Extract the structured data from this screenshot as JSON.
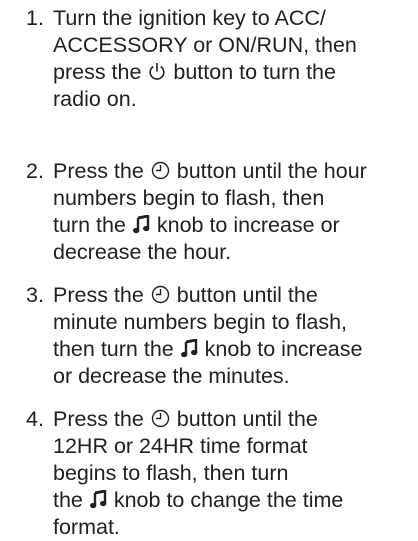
{
  "steps": [
    {
      "number": "1.",
      "lines": [
        [
          "Turn the ignition key to ACC/"
        ],
        [
          "ACCESSORY or ON/RUN, then"
        ],
        [
          "press the ",
          "power-icon",
          " button to turn the"
        ],
        [
          "radio on."
        ]
      ]
    },
    {
      "number": "2.",
      "lines": [
        [
          "Press the ",
          "clock-icon",
          " button until the hour"
        ],
        [
          "numbers begin to flash, then"
        ],
        [
          "turn the ",
          "music-note-icon",
          " knob to increase or"
        ],
        [
          "decrease the hour."
        ]
      ]
    },
    {
      "number": "3.",
      "lines": [
        [
          "Press the ",
          "clock-icon",
          " button until the"
        ],
        [
          "minute numbers begin to flash,"
        ],
        [
          "then turn the ",
          "music-note-icon",
          " knob to increase"
        ],
        [
          "or decrease the minutes."
        ]
      ]
    },
    {
      "number": "4.",
      "lines": [
        [
          "Press the ",
          "clock-icon",
          " button until the"
        ],
        [
          "12HR or 24HR time format"
        ],
        [
          "begins to flash, then turn"
        ],
        [
          "the ",
          "music-note-icon",
          " knob to change the time"
        ],
        [
          "format."
        ]
      ]
    }
  ]
}
